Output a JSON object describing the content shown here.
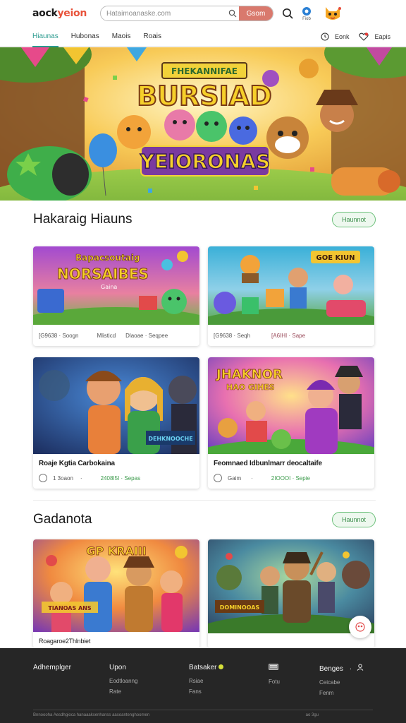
{
  "header": {
    "logo_a": "aock",
    "logo_b": "yeion",
    "search_placeholder": "Hataimoanaske.com",
    "search_button": "Gsom",
    "icon_badge_label": "Fiob"
  },
  "nav": {
    "tabs": [
      "Hiaunas",
      "Hubonas",
      "Maois",
      "Roais"
    ],
    "right": [
      {
        "icon": "clock-icon",
        "label": "Eonk"
      },
      {
        "icon": "heart-icon",
        "label": "Eapis"
      }
    ]
  },
  "hero": {
    "line1": "FHEKANNIFAE",
    "line2": "BURSIAD",
    "line3": "YEIORONAS",
    "colors": {
      "sky": "#f6c24a",
      "accent": "#e64a8a",
      "banner": "#c14aa0"
    }
  },
  "section1": {
    "title": "Hakaraig Hiauns",
    "button": "Haunnot",
    "cards": [
      {
        "overlay_a": "Bapacsoutaig",
        "overlay_b": "NORSAIBES",
        "overlay_c": "Gaina",
        "meta": [
          "[G9638 · Soogn",
          "Mlisticd",
          "Dlaoae · Seqpee"
        ]
      },
      {
        "overlay_a": "GOE KIUN",
        "meta": [
          "[G9638 · Seqh",
          "[A6IHI · Sape"
        ]
      },
      {
        "title": "Roaje Kgtia Carbokaina",
        "overlay_a": "DEHKNOOCHE",
        "meta": [
          "1 3oaon",
          "·",
          "2408I5I · Sepas"
        ]
      },
      {
        "title": "Feomnaed Idbunlmarr deocaltaife",
        "overlay_a": "JHAKNOR",
        "overlay_b": "HAO GIHES",
        "meta": [
          "Gaim",
          "·",
          "2IOOOI · Sepie"
        ]
      }
    ]
  },
  "section2": {
    "title": "Gadanota",
    "button": "Haunnot",
    "cards": [
      {
        "title": "Roagaroe2Thlnbiet",
        "overlay_a": "GP KRAIII",
        "overlay_b": "TIANOAS ANS"
      },
      {
        "overlay_a": "DOMINOOAS"
      }
    ]
  },
  "footer": {
    "cols": [
      {
        "head": "Adhemplger",
        "links": []
      },
      {
        "head": "Upon",
        "links": [
          "Eodtloanng",
          "Rate"
        ]
      },
      {
        "head": "Batsaker",
        "links": [
          "Rsiae",
          "Fans"
        ]
      },
      {
        "head": "",
        "links": [
          "Fotu"
        ]
      },
      {
        "head": "Benges",
        "links": [
          "Ceicabe",
          "Fenm"
        ]
      }
    ],
    "bottom_left": "Bnnoooha Aesdhgioca hanaaaksenhanss aasoantenghoomen",
    "bottom_right": "ao 3gu"
  }
}
